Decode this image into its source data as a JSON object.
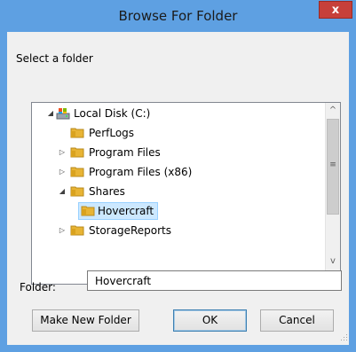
{
  "window": {
    "title": "Browse For Folder",
    "close_label": "x"
  },
  "prompt": "Select a folder",
  "tree": {
    "items": [
      {
        "label": "Local Disk (C:)",
        "expander": "◢",
        "icon": "drive-icon",
        "selected": false
      },
      {
        "label": "PerfLogs",
        "expander": "",
        "icon": "folder-icon",
        "selected": false
      },
      {
        "label": "Program Files",
        "expander": "▷",
        "icon": "folder-icon",
        "selected": false
      },
      {
        "label": "Program Files (x86)",
        "expander": "▷",
        "icon": "folder-icon",
        "selected": false
      },
      {
        "label": "Shares",
        "expander": "◢",
        "icon": "folder-icon",
        "selected": false
      },
      {
        "label": "Hovercraft",
        "expander": "",
        "icon": "folder-icon",
        "selected": true
      },
      {
        "label": "StorageReports",
        "expander": "▷",
        "icon": "folder-icon",
        "selected": false
      }
    ],
    "scroll_up": "^",
    "scroll_down": "v",
    "scroll_grip": "≡"
  },
  "folder_field": {
    "label": "Folder:",
    "value": "Hovercraft"
  },
  "buttons": {
    "make_new_folder": "Make New Folder",
    "ok": "OK",
    "cancel": "Cancel"
  },
  "colors": {
    "title_bar": "#5ea0e2",
    "close_button": "#c7403a",
    "selection": "#cce8ff",
    "folder": "#e8b434"
  }
}
